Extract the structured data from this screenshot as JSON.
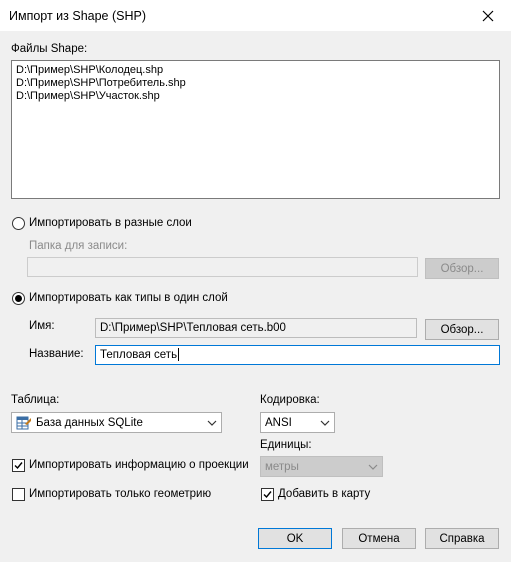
{
  "window": {
    "title": "Импорт из Shape (SHP)"
  },
  "files": {
    "label": "Файлы Shape:",
    "items": [
      "D:\\Пример\\SHP\\Колодец.shp",
      "D:\\Пример\\SHP\\Потребитель.shp",
      "D:\\Пример\\SHP\\Участок.shp"
    ]
  },
  "separate_layers": {
    "radio_label": "Импортировать в разные слои",
    "selected": false,
    "folder_label": "Папка для записи:",
    "folder_value": "",
    "browse_label": "Обзор..."
  },
  "single_layer": {
    "radio_label": "Импортировать как типы в один слой",
    "selected": true,
    "name_label": "Имя:",
    "name_value": "D:\\Пример\\SHP\\Тепловая сеть.b00",
    "browse_label": "Обзор...",
    "title_label": "Название:",
    "title_value": "Тепловая сеть"
  },
  "table": {
    "label": "Таблица:",
    "selected": "База данных SQLite",
    "icon": "database-icon"
  },
  "encoding": {
    "label": "Кодировка:",
    "selected": "ANSI"
  },
  "units": {
    "label": "Единицы:",
    "selected": "метры"
  },
  "options": {
    "import_projection": {
      "label": "Импортировать информацию о проекции",
      "checked": true
    },
    "geometry_only": {
      "label": "Импортировать только геометрию",
      "checked": false
    },
    "add_to_map": {
      "label": "Добавить в карту",
      "checked": true
    }
  },
  "buttons": {
    "ok": "OK",
    "cancel": "Отмена",
    "help": "Справка"
  }
}
